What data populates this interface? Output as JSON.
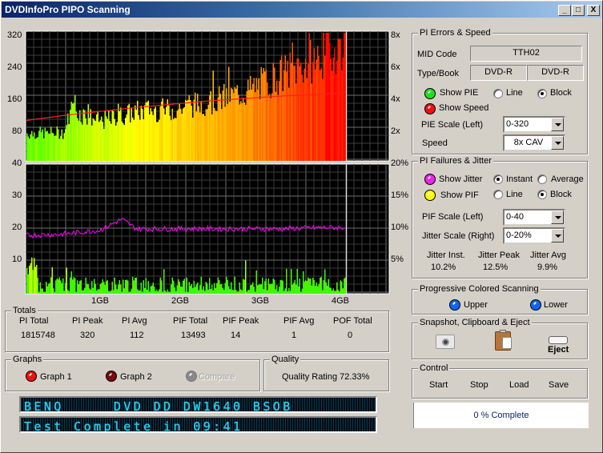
{
  "window": {
    "title": "DVDInfoPro PIPO Scanning",
    "controls": {
      "minimize": "_",
      "maximize": "□",
      "close": "X"
    }
  },
  "chart_data": [
    {
      "type": "bar",
      "title": "PI Errors & Speed",
      "y_left_ticks": [
        "320",
        "240",
        "160",
        "80",
        "40"
      ],
      "y_right_ticks": [
        "8x",
        "6x",
        "4x",
        "2x"
      ],
      "ylim_left": [
        0,
        320
      ],
      "ylim_right": [
        0,
        8
      ],
      "xlabel": "",
      "x_ticks": [
        "1GB",
        "2GB",
        "3GB",
        "4GB"
      ],
      "xlim_gb": [
        0,
        4.7
      ],
      "data_end_gb": 4.38,
      "grid": true,
      "series": [
        {
          "name": "PIE",
          "style": "block",
          "color_gradient": [
            "#66ff00",
            "#ffff00",
            "#ff9900",
            "#ff0000"
          ],
          "approx_profile_gb": [
            0,
            0.5,
            0.6,
            1.0,
            1.5,
            2.0,
            2.5,
            3.0,
            3.5,
            4.0,
            4.38
          ],
          "approx_values": [
            70,
            72,
            130,
            100,
            125,
            130,
            150,
            175,
            220,
            260,
            300
          ]
        },
        {
          "name": "Speed",
          "style": "line",
          "color": "#ff2020",
          "x_gb": [
            0,
            0.5,
            1.0,
            1.5,
            2.0,
            2.5,
            3.0,
            3.5,
            4.0,
            4.38
          ],
          "values_x": [
            2.5,
            2.8,
            3.05,
            3.3,
            3.5,
            3.7,
            3.85,
            4.0,
            4.1,
            4.2
          ]
        }
      ]
    },
    {
      "type": "bar",
      "title": "PI Failures & Jitter",
      "y_left_ticks": [
        "30",
        "20",
        "10"
      ],
      "y_right_ticks": [
        "20%",
        "15%",
        "10%",
        "5%"
      ],
      "ylim_left": [
        0,
        40
      ],
      "ylim_right": [
        0,
        20
      ],
      "x_ticks": [
        "1GB",
        "2GB",
        "3GB",
        "4GB"
      ],
      "xlim_gb": [
        0,
        4.7
      ],
      "data_end_gb": 4.38,
      "grid": true,
      "series": [
        {
          "name": "PIF",
          "style": "block",
          "color": "#33ff00",
          "typical": 3,
          "peak": 14
        },
        {
          "name": "Jitter",
          "style": "line",
          "color": "#ff00ff",
          "x_gb": [
            0,
            0.5,
            1.0,
            1.3,
            1.5,
            2.0,
            2.5,
            3.0,
            3.5,
            4.0,
            4.38
          ],
          "values_pct": [
            9.0,
            9.2,
            9.8,
            11.5,
            10.0,
            10.0,
            10.0,
            10.0,
            10.0,
            10.2,
            10.2
          ]
        }
      ]
    }
  ],
  "pi_errors": {
    "title": "PI Errors & Speed",
    "mid_label": "MID Code",
    "mid_value": "TTH02",
    "type_label": "Type/Book",
    "type_value": "DVD-R",
    "book_value": "DVD-R",
    "show_pie": "Show PIE",
    "line": "Line",
    "block": "Block",
    "show_speed": "Show Speed",
    "pie_scale_label": "PIE Scale (Left)",
    "pie_scale_value": "0-320",
    "speed_label": "Speed",
    "speed_value": "8x CAV",
    "pie_color": "#22dd22",
    "speed_color": "#ee1111"
  },
  "pi_failures": {
    "title": "PI Failures & Jitter",
    "show_jitter": "Show Jitter",
    "instant": "Instant",
    "average": "Average",
    "show_pif": "Show PIF",
    "line": "Line",
    "block": "Block",
    "pif_scale_label": "PIF Scale (Left)",
    "pif_scale_value": "0-40",
    "jitter_scale_label": "Jitter Scale (Right)",
    "jitter_scale_value": "0-20%",
    "jitter_inst_label": "Jitter Inst.",
    "jitter_inst_value": "10.2%",
    "jitter_peak_label": "Jitter Peak",
    "jitter_peak_value": "12.5%",
    "jitter_avg_label": "Jitter Avg",
    "jitter_avg_value": "9.9%",
    "jitter_color": "#ee22ee",
    "pif_color": "#ffff00"
  },
  "progressive": {
    "title": "Progressive Colored Scanning",
    "upper": "Upper",
    "lower": "Lower",
    "color": "#1166ee"
  },
  "snapshot": {
    "title": "Snapshot,  Clipboard  & Eject",
    "eject": "Eject"
  },
  "control": {
    "title": "Control",
    "start": "Start",
    "stop": "Stop",
    "load": "Load",
    "save": "Save",
    "progress": "0 % Complete"
  },
  "totals": {
    "title": "Totals",
    "headers": [
      "PI Total",
      "PI Peak",
      "PI Avg",
      "PIF Total",
      "PIF Peak",
      "PIF Avg",
      "POF Total"
    ],
    "values": [
      "1815748",
      "320",
      "112",
      "13493",
      "14",
      "1",
      "0"
    ]
  },
  "graphs": {
    "title": "Graphs",
    "graph1": "Graph 1",
    "graph2": "Graph 2",
    "compare": "Compare"
  },
  "quality": {
    "title": "Quality",
    "rating": "Quality Rating 72.33%"
  },
  "lcd": {
    "line1": "BENQ     DVD DD DW1640 BSOB",
    "line2": "Test Complete in 09:41"
  }
}
